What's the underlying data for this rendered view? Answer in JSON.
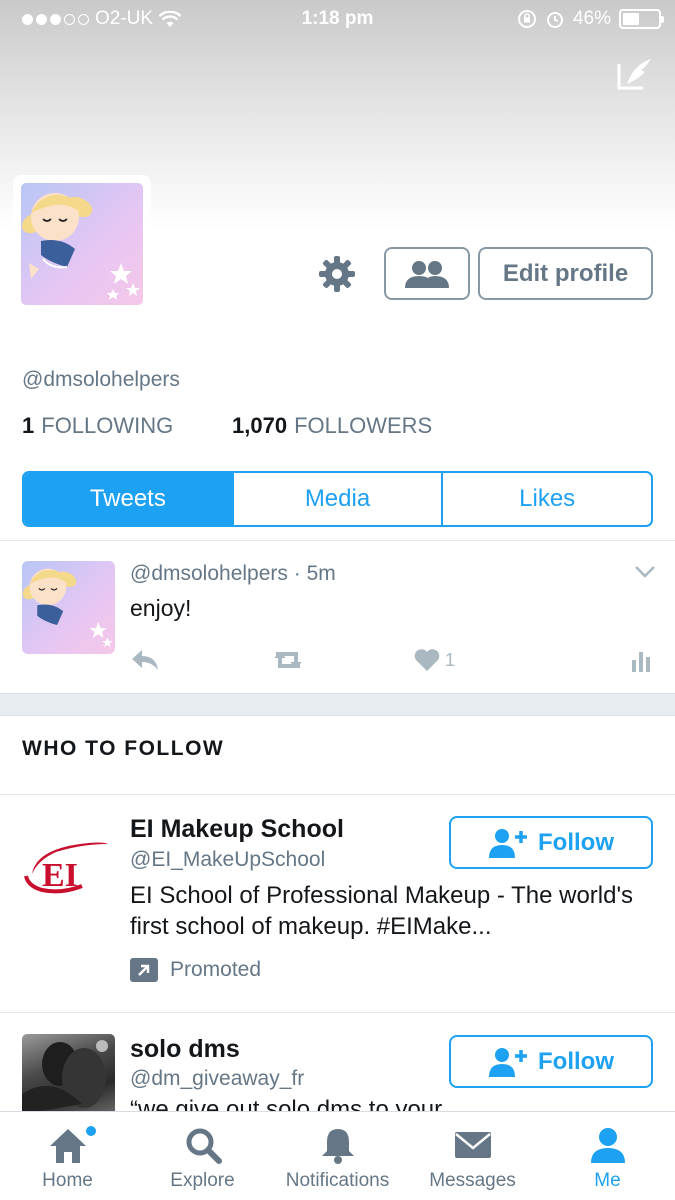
{
  "status_bar": {
    "carrier": "O2-UK",
    "time": "1:18 pm",
    "battery": "46%",
    "battery_level": 0.46
  },
  "profile": {
    "handle": "@dmsolohelpers",
    "following_count": "1",
    "following_label": "FOLLOWING",
    "followers_count": "1,070",
    "followers_label": "FOLLOWERS",
    "edit_profile_label": "Edit profile"
  },
  "tabs": [
    {
      "label": "Tweets",
      "active": true
    },
    {
      "label": "Media",
      "active": false
    },
    {
      "label": "Likes",
      "active": false
    }
  ],
  "tweet": {
    "handle": "@dmsolohelpers",
    "separator": "·",
    "time": "5m",
    "text": "enjoy!",
    "like_count": "1"
  },
  "who_to_follow": {
    "title": "WHO TO FOLLOW",
    "follow_label": "Follow",
    "suggestions": [
      {
        "name": "EI Makeup School",
        "handle": "@EI_MakeUpSchool",
        "bio": "EI School of Professional Makeup - The world's first school of makeup. #EIMake...",
        "promoted_label": "Promoted",
        "logo_text": "EI"
      },
      {
        "name": "solo dms",
        "handle": "@dm_giveaway_fr",
        "bio_partial": "“we give out solo dms to your"
      }
    ]
  },
  "nav": [
    {
      "label": "Home",
      "icon": "home-icon"
    },
    {
      "label": "Explore",
      "icon": "search-icon"
    },
    {
      "label": "Notifications",
      "icon": "bell-icon"
    },
    {
      "label": "Messages",
      "icon": "envelope-icon"
    },
    {
      "label": "Me",
      "icon": "person-icon",
      "active": true
    }
  ],
  "colors": {
    "accent": "#1da1f2",
    "muted": "#657786",
    "icon_gray": "#aab8c2",
    "ei_red": "#c8102e"
  }
}
